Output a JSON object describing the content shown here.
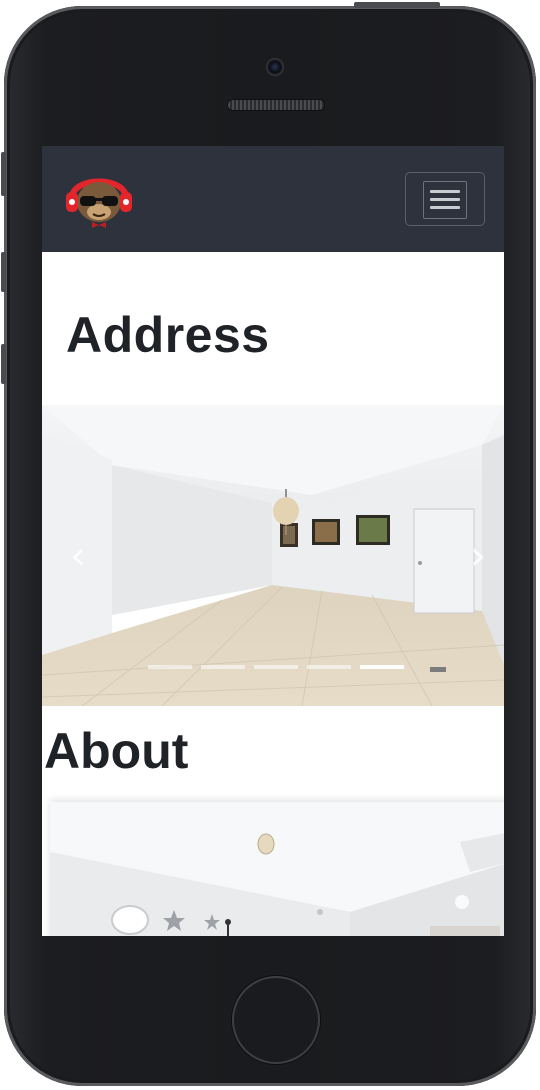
{
  "device": {
    "model": "iPhone",
    "frame_color": "#1c1d20"
  },
  "navbar": {
    "background": "#2d323d",
    "logo_icon": "dj-cat-logo-icon",
    "menu_icon": "hamburger-menu-icon"
  },
  "address": {
    "heading": "Address"
  },
  "carousel": {
    "prev_icon": "chevron-left-icon",
    "next_icon": "chevron-right-icon",
    "prev_glyph": "‹",
    "next_glyph": "›",
    "slide_count": 5,
    "active_slide": 5
  },
  "about": {
    "heading": "About"
  }
}
